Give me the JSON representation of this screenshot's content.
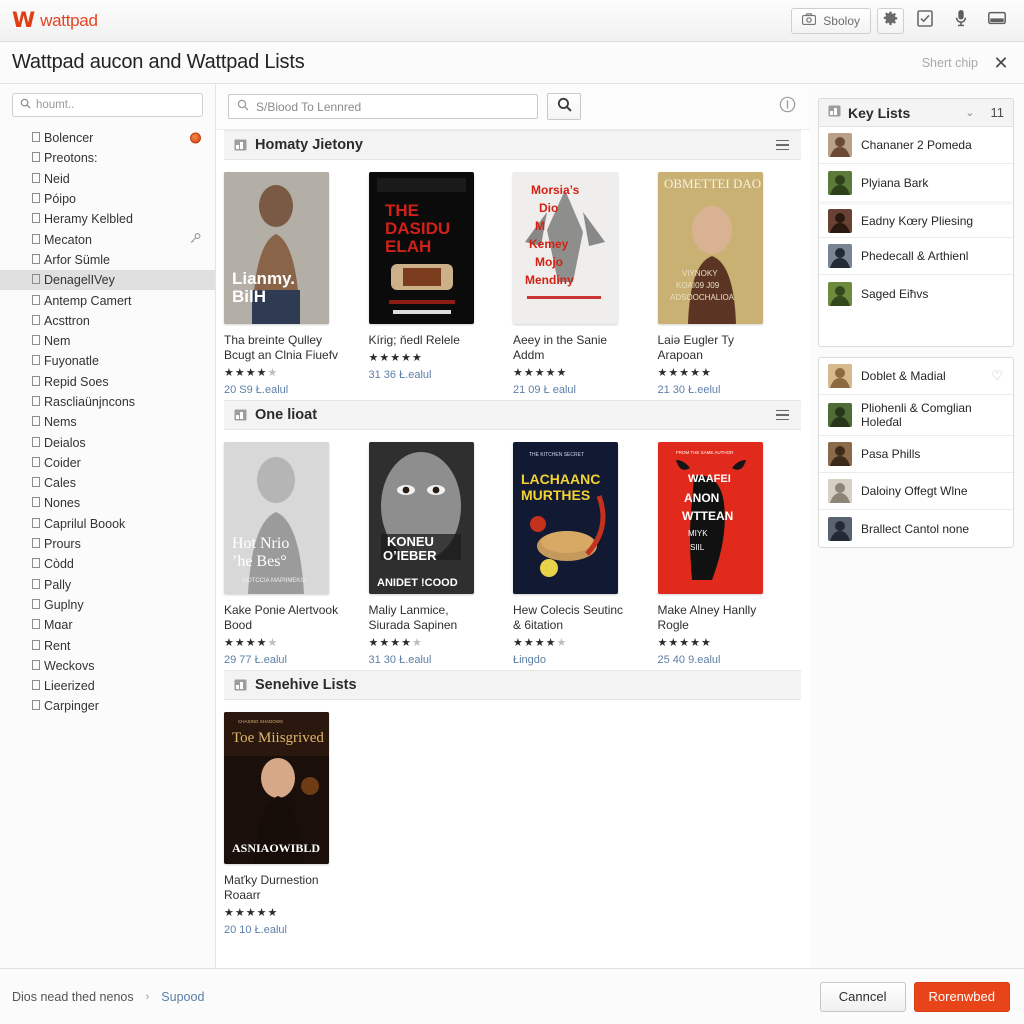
{
  "brand": {
    "mark": "W",
    "name": "wattpad"
  },
  "toolbar": {
    "buttons": [
      {
        "name": "sboloy-button",
        "label": "Sboloy",
        "icon": "camera-icon"
      },
      {
        "name": "settings-button",
        "label": "",
        "icon": "gear-icon"
      },
      {
        "name": "checkbox-button",
        "label": "",
        "icon": "checkbox-icon"
      },
      {
        "name": "mic-button",
        "label": "",
        "icon": "microphone-icon"
      },
      {
        "name": "card-button",
        "label": "",
        "icon": "card-icon"
      }
    ]
  },
  "titlebar": {
    "title": "Wattpad aucon and Wattpad Lists",
    "chip": "Shert chip",
    "close": "✕"
  },
  "sidebar": {
    "search_placeholder": "houmt..",
    "items": [
      {
        "label": "Bolencer",
        "badge": true,
        "right_icon": ""
      },
      {
        "label": "Preotons:",
        "badge": false,
        "right_icon": ""
      },
      {
        "label": "Neid",
        "badge": false,
        "right_icon": ""
      },
      {
        "label": "Póipo",
        "badge": false,
        "right_icon": ""
      },
      {
        "label": "Heramy Kelbled",
        "badge": false,
        "right_icon": ""
      },
      {
        "label": "Mecaton",
        "badge": false,
        "right_icon": "key-icon"
      },
      {
        "label": "Arfor Sümle",
        "badge": false,
        "right_icon": ""
      },
      {
        "label": "DenagelIVey",
        "badge": false,
        "right_icon": "",
        "selected": true
      },
      {
        "label": "Antemp Camert",
        "badge": false,
        "right_icon": ""
      },
      {
        "label": "Acsttron",
        "badge": false,
        "right_icon": ""
      },
      {
        "label": "Nem",
        "badge": false,
        "right_icon": ""
      },
      {
        "label": "Fuyonatle",
        "badge": false,
        "right_icon": ""
      },
      {
        "label": "Repid Soes",
        "badge": false,
        "right_icon": ""
      },
      {
        "label": "Rascliaünjncons",
        "badge": false,
        "right_icon": ""
      },
      {
        "label": "Nems",
        "badge": false,
        "right_icon": ""
      },
      {
        "label": "Deialos",
        "badge": false,
        "right_icon": ""
      },
      {
        "label": "Coider",
        "badge": false,
        "right_icon": ""
      },
      {
        "label": "Cales",
        "badge": false,
        "right_icon": ""
      },
      {
        "label": "Nones",
        "badge": false,
        "right_icon": ""
      },
      {
        "label": "Caprilul Boook",
        "badge": false,
        "right_icon": ""
      },
      {
        "label": "Prours",
        "badge": false,
        "right_icon": ""
      },
      {
        "label": "Còdd",
        "badge": false,
        "right_icon": ""
      },
      {
        "label": "Pally",
        "badge": false,
        "right_icon": ""
      },
      {
        "label": "Guplny",
        "badge": false,
        "right_icon": ""
      },
      {
        "label": "Mɑar",
        "badge": false,
        "right_icon": ""
      },
      {
        "label": "Rent",
        "badge": false,
        "right_icon": ""
      },
      {
        "label": "Weckovs",
        "badge": false,
        "right_icon": ""
      },
      {
        "label": "Lieerized",
        "badge": false,
        "right_icon": ""
      },
      {
        "label": "Carpinger",
        "badge": false,
        "right_icon": ""
      }
    ]
  },
  "search": {
    "placeholder": "S/Biood To Lennred",
    "search_icon": "search-icon",
    "go_icon": "search-icon",
    "info_icon": "info-icon"
  },
  "sections": [
    {
      "title": "Homaty Jietony",
      "icon": "book-icon",
      "menu_icon": "hamburger-icon",
      "cards": [
        {
          "cover_text": "Lianmy. BilH",
          "cover_style": "photo-man",
          "title": "Thа breinte Qulley Bcugt an Clnia Fiuefv",
          "stars": 4,
          "meta": "20 S9 Ł.ealul"
        },
        {
          "cover_text": "THE DASIDU ELAH",
          "cover_style": "dark-red",
          "title": "Kírig; ňedl Relele",
          "stars": 5,
          "meta": "31 36 Ł.ealul"
        },
        {
          "cover_text": "Morsia's Dio M Kemey Mojo Mendiny",
          "cover_style": "white-red",
          "title": "Aeey in the Sanie Addm",
          "stars": 5,
          "meta": "21 09 Ł ealul"
        },
        {
          "cover_text": "OBMETTEI DAO",
          "cover_style": "olive-man",
          "title": "Laiə Eugler Ty Arapoan",
          "stars": 5,
          "meta": "21 30 Ł.eelul"
        }
      ]
    },
    {
      "title": "One lioat",
      "icon": "book-icon",
      "menu_icon": "hamburger-icon",
      "cards": [
        {
          "cover_text": "Hot Nrio 'he Bes°",
          "cover_style": "gray-man",
          "title": "Kake Ponie Alertvook Bood",
          "stars": 4,
          "meta": "29 77 Ł.ealul"
        },
        {
          "cover_text": "KONEU O'IEBER",
          "cover_style": "bw-woman",
          "title": "Maliy Lanmice, Siurada Sapinen",
          "stars": 4,
          "meta": "31 30 Ł.ealul"
        },
        {
          "cover_text": "LACHAANC MURTHES",
          "cover_style": "navy-food",
          "title": "Hew Colecis Seutinc & 6itation",
          "stars": 4,
          "meta": "Łingdo"
        },
        {
          "cover_text": "WAAFEI ANON WTTEAN",
          "cover_style": "red-silhouette",
          "title": "Make Alney Hanlly Rogle",
          "stars": 5,
          "meta": "25 40 9.ealul"
        }
      ]
    },
    {
      "title": "Senehive Lists",
      "icon": "book-icon",
      "menu_icon": "",
      "cards": [
        {
          "cover_text": "Toe Miisgrived ASNIAOWIBLD",
          "cover_style": "warm-woman",
          "title": "Maťky Durnestion Roaarr",
          "stars": 5,
          "meta": "20 10 Ł.ealul"
        }
      ]
    }
  ],
  "right_panel": {
    "title": "Key Lists",
    "icon": "book-icon",
    "chevron": "⌄",
    "count": "11",
    "group_one": [
      {
        "name": "Chananer 2 Pomeda",
        "avatar": "avatar-glasses"
      },
      {
        "name": "Plyiana Bark",
        "avatar": "avatar-green"
      }
    ],
    "group_two": [
      {
        "name": "Eadny Kœry Pliesing",
        "avatar": "avatar-woman"
      },
      {
        "name": "Phedecall & Arthienl",
        "avatar": "avatar-suit"
      },
      {
        "name": "Saged Eiħvs",
        "avatar": "avatar-plant"
      }
    ],
    "group_three": [
      {
        "name": "Doblet & Madial",
        "avatar": "avatar-blonde",
        "heart": true
      },
      {
        "name": "Pliohenli & Comglian Holeɗal",
        "avatar": "avatar-forest",
        "heart": false
      },
      {
        "name": "Pasa Phills",
        "avatar": "avatar-brown",
        "heart": false
      },
      {
        "name": "Daloiny Offegt Wlne",
        "avatar": "avatar-light",
        "heart": false
      },
      {
        "name": "Brallect Cantol none",
        "avatar": "avatar-dark",
        "heart": false
      }
    ]
  },
  "footer": {
    "crumb": "Dios nead thed nenos",
    "crumb_sep": "›",
    "crumb_link": "Supood",
    "cancel_label": "Canncel",
    "primary_label": "Rorenwbed"
  }
}
